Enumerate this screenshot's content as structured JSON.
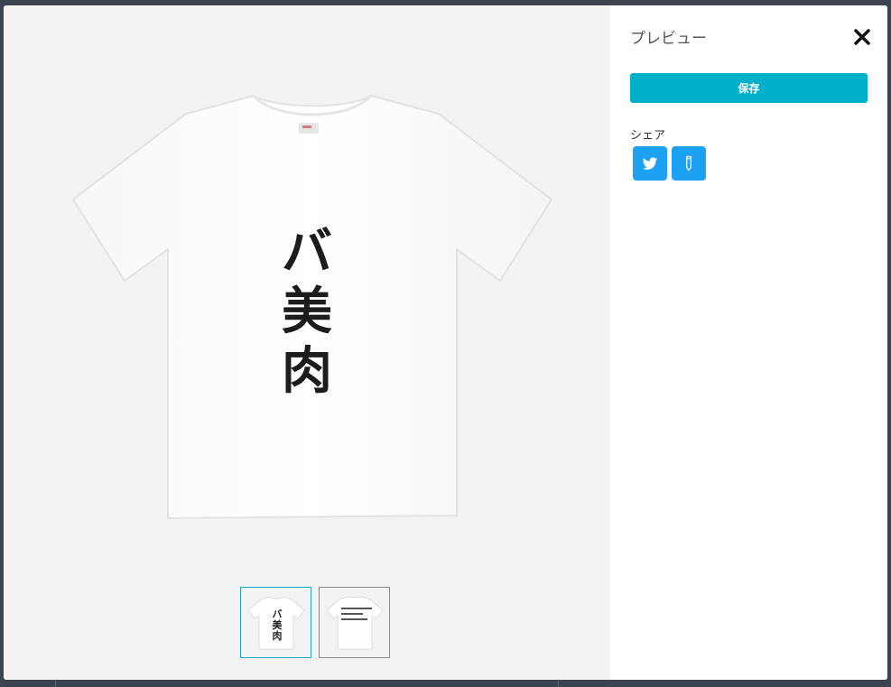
{
  "modal": {
    "title": "プレビュー",
    "save_label": "保存",
    "share_label": "シェア"
  },
  "preview": {
    "design_lines": [
      "バ",
      "美",
      "肉"
    ],
    "thumbnails": [
      {
        "name": "front",
        "active": true
      },
      {
        "name": "back",
        "active": false
      }
    ]
  },
  "icons": {
    "close": "close-icon",
    "twitter": "twitter-icon",
    "pencil": "pencil-icon"
  },
  "colors": {
    "accent": "#00b0cb",
    "share": "#1da1f2",
    "thumb_active_border": "#21a7c4",
    "overlay": "#3d4450"
  }
}
